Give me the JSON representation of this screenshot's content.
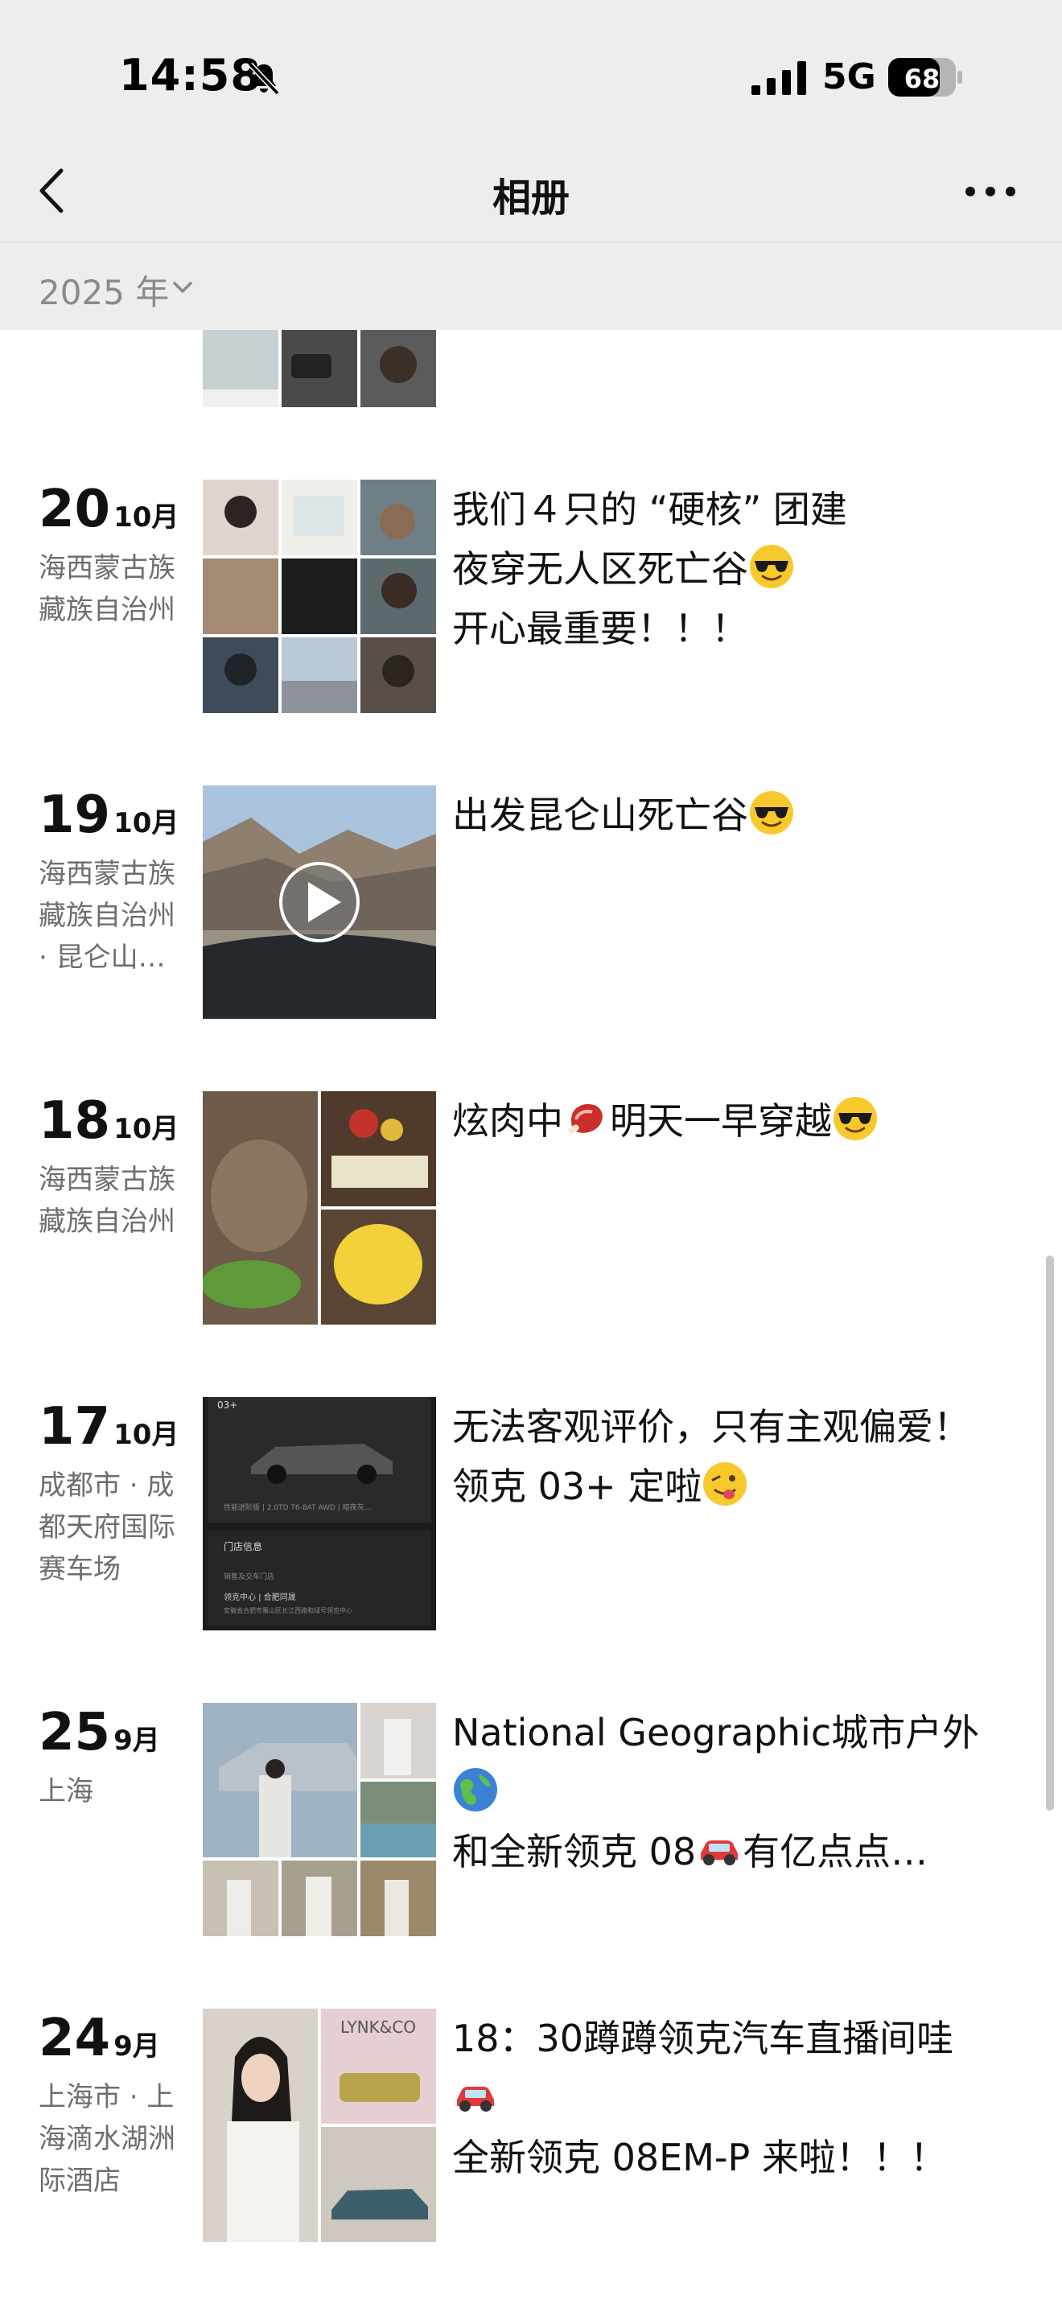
{
  "status_bar": {
    "time": "14:58",
    "network": "5G",
    "battery": "68"
  },
  "nav": {
    "title": "相册",
    "back_icon": "chevron-left-icon",
    "more_icon": "more-dots-icon"
  },
  "year_selector": {
    "label": "2025 年",
    "icon": "chevron-down-icon"
  },
  "entries": [
    {
      "day": "20",
      "month": "10月",
      "location": "海西蒙古族藏族自治州",
      "caption": [
        "我们４只的 “硬核” 团建",
        "夜穿无人区死亡谷",
        "开心最重要！！！"
      ],
      "emojis": [
        "smiling-face-with-sunglasses"
      ],
      "media": "photo-grid-9"
    },
    {
      "day": "19",
      "month": "10月",
      "location": "海西蒙古族藏族自治州 · 昆仑山…",
      "caption": [
        "出发昆仑山死亡谷"
      ],
      "emojis": [
        "smiling-face-with-sunglasses"
      ],
      "media": "video"
    },
    {
      "day": "18",
      "month": "10月",
      "location": "海西蒙古族藏族自治州",
      "caption": [
        "炫肉中",
        "明天一早穿越"
      ],
      "emojis": [
        "meat-on-bone",
        "smiling-face-with-sunglasses"
      ],
      "media": "photo-grid-3"
    },
    {
      "day": "17",
      "month": "10月",
      "location": "成都市 · 成都天府国际赛车场",
      "caption": [
        "无法客观评价，只有主观偏爱！",
        "领克 03+ 定啦"
      ],
      "emojis": [
        "face-with-tongue-wink"
      ],
      "media": "screenshot",
      "screenshot_text": {
        "badge": "03+",
        "spec": "性能进阶版 | 2.0TD T6-8AT AWD | 暗夜灰…",
        "store_title": "门店信息",
        "store_sub": "销售及交车门店",
        "store_name": "领克中心 | 合肥同晟",
        "store_addr": "安徽省合肥市蜀山区长江西路和绿号领克中心"
      }
    },
    {
      "day": "25",
      "month": "9月",
      "location": "上海",
      "caption": [
        "National Geographic城市户外",
        "和全新领克 08",
        "有亿点点…"
      ],
      "emojis": [
        "globe-icon",
        "red-car"
      ],
      "media": "photo-grid-7"
    },
    {
      "day": "24",
      "month": "9月",
      "location": "上海市 · 上海滴水湖洲际酒店",
      "caption": [
        "18：30蹲蹲领克汽车直播间哇",
        "全新领克 08EM-P 来啦！！！"
      ],
      "emojis": [
        "red-car"
      ],
      "media": "photo-grid-3",
      "logo_text": "LYNK&CO"
    }
  ],
  "colors": {
    "header_bg": "#ededed",
    "secondary_text": "#6e6e6e",
    "year_text": "#8a8a8a"
  }
}
